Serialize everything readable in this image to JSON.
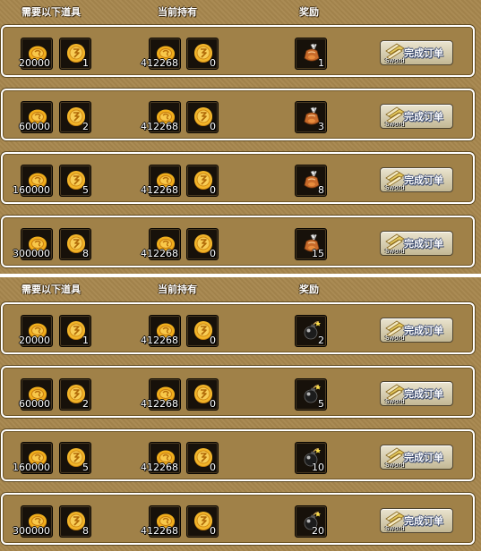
{
  "headers": {
    "required": "需要以下道具",
    "current": "当前持有",
    "reward": "奖励"
  },
  "button": {
    "label": "完成订单",
    "ticket_caption": "Sword"
  },
  "colors": {
    "panel": "#a7874e",
    "slot": "#17110a",
    "coin": "#e6a516",
    "button": "#d8cfb2"
  },
  "icons": {
    "coin": "gold-coin-icon",
    "token": "gold-token-icon",
    "pouch": "material-pouch-icon",
    "bomb": "bomb-icon",
    "ticket": "sword-ticket-icon"
  },
  "panels": [
    {
      "reward_icon": "material-pouch-icon",
      "rows": [
        {
          "req_coin": "20000",
          "req_token": "1",
          "have_coin": "412268",
          "have_token": "0",
          "reward": "1"
        },
        {
          "req_coin": "60000",
          "req_token": "2",
          "have_coin": "412268",
          "have_token": "0",
          "reward": "3"
        },
        {
          "req_coin": "160000",
          "req_token": "5",
          "have_coin": "412268",
          "have_token": "0",
          "reward": "8"
        },
        {
          "req_coin": "300000",
          "req_token": "8",
          "have_coin": "412268",
          "have_token": "0",
          "reward": "15"
        }
      ]
    },
    {
      "reward_icon": "bomb-icon",
      "rows": [
        {
          "req_coin": "20000",
          "req_token": "1",
          "have_coin": "412268",
          "have_token": "0",
          "reward": "2"
        },
        {
          "req_coin": "60000",
          "req_token": "2",
          "have_coin": "412268",
          "have_token": "0",
          "reward": "5"
        },
        {
          "req_coin": "160000",
          "req_token": "5",
          "have_coin": "412268",
          "have_token": "0",
          "reward": "10"
        },
        {
          "req_coin": "300000",
          "req_token": "8",
          "have_coin": "412268",
          "have_token": "0",
          "reward": "20"
        }
      ]
    }
  ]
}
